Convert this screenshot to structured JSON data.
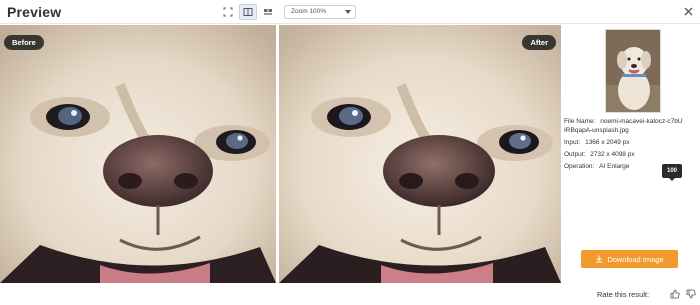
{
  "header": {
    "title": "Preview",
    "zoom": {
      "selected": "Zoom 100%"
    },
    "view_buttons": [
      "fit-view",
      "split-view",
      "side-by-side-view"
    ],
    "close_icon": "close-icon"
  },
  "compare": {
    "before_label": "Before",
    "after_label": "After"
  },
  "info": {
    "file_name_label": "File Name:",
    "file_name_value": "noemi-macavei-katocz-c7bU",
    "file_name_cont": "IRBqapA-unsplash.jpg",
    "input_label": "Input:",
    "input_value": "1366 x 2049 px",
    "output_label": "Output:",
    "output_value": "2732 x 4098 px",
    "operation_label": "Operation:",
    "operation_value": "AI Enlarge",
    "badge_value": "100",
    "download_label": "Download Image"
  },
  "footer": {
    "rate_label": "Rate this result:"
  },
  "colors": {
    "accent_orange": "#f29a2e",
    "tag_bg": "#1e1e1e"
  }
}
